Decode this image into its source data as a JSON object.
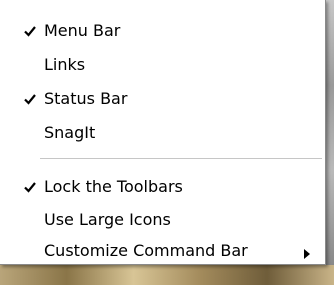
{
  "menu": {
    "items": [
      {
        "label": "Menu Bar",
        "checked": true
      },
      {
        "label": "Links",
        "checked": false
      },
      {
        "label": "Status Bar",
        "checked": true
      },
      {
        "label": "SnagIt",
        "checked": false
      },
      {
        "label": "Lock the Toolbars",
        "checked": true
      },
      {
        "label": "Use Large Icons",
        "checked": false
      },
      {
        "label": "Customize Command Bar",
        "checked": false,
        "has_submenu": true
      }
    ]
  },
  "icons": {
    "check": "checkmark-icon",
    "submenu": "submenu-arrow-icon"
  },
  "colors": {
    "menu_background": "#ffffff",
    "text": "#000000",
    "separator": "#c6c6c6"
  }
}
